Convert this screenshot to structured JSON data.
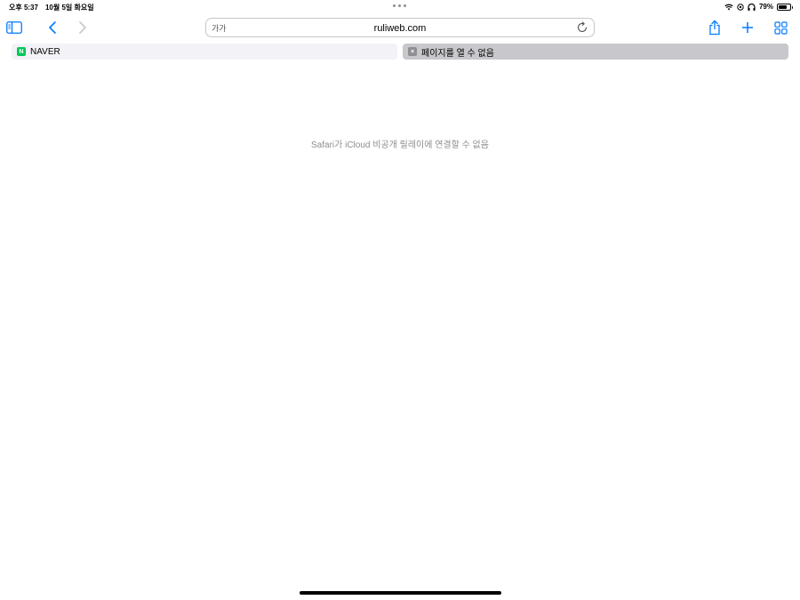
{
  "status_bar": {
    "time": "오후 5:37",
    "date": "10월 5일 화요일",
    "battery_percent": "79%",
    "battery_level": 0.79,
    "icons": [
      "wifi-icon",
      "location-icon",
      "headphones-icon",
      "battery-icon"
    ]
  },
  "toolbar": {
    "sidebar_icon": "sidebar-icon",
    "back_icon": "chevron-left-icon",
    "forward_icon": "chevron-right-icon",
    "share_icon": "share-icon",
    "new_tab_icon": "plus-icon",
    "tabs_overview_icon": "grid-icon",
    "accent_color": "#007aff"
  },
  "address_bar": {
    "reader_label": "가가",
    "url": "ruliweb.com",
    "reload_icon": "reload-icon"
  },
  "tabs": [
    {
      "label": "NAVER",
      "favicon_letter": "N",
      "active": false
    },
    {
      "label": "페이지를 열 수 없음",
      "favicon_letter": "×",
      "active": true
    }
  ],
  "content": {
    "error_message": "Safari가 iCloud 비공개 릴레이에 연결할 수 없음"
  }
}
